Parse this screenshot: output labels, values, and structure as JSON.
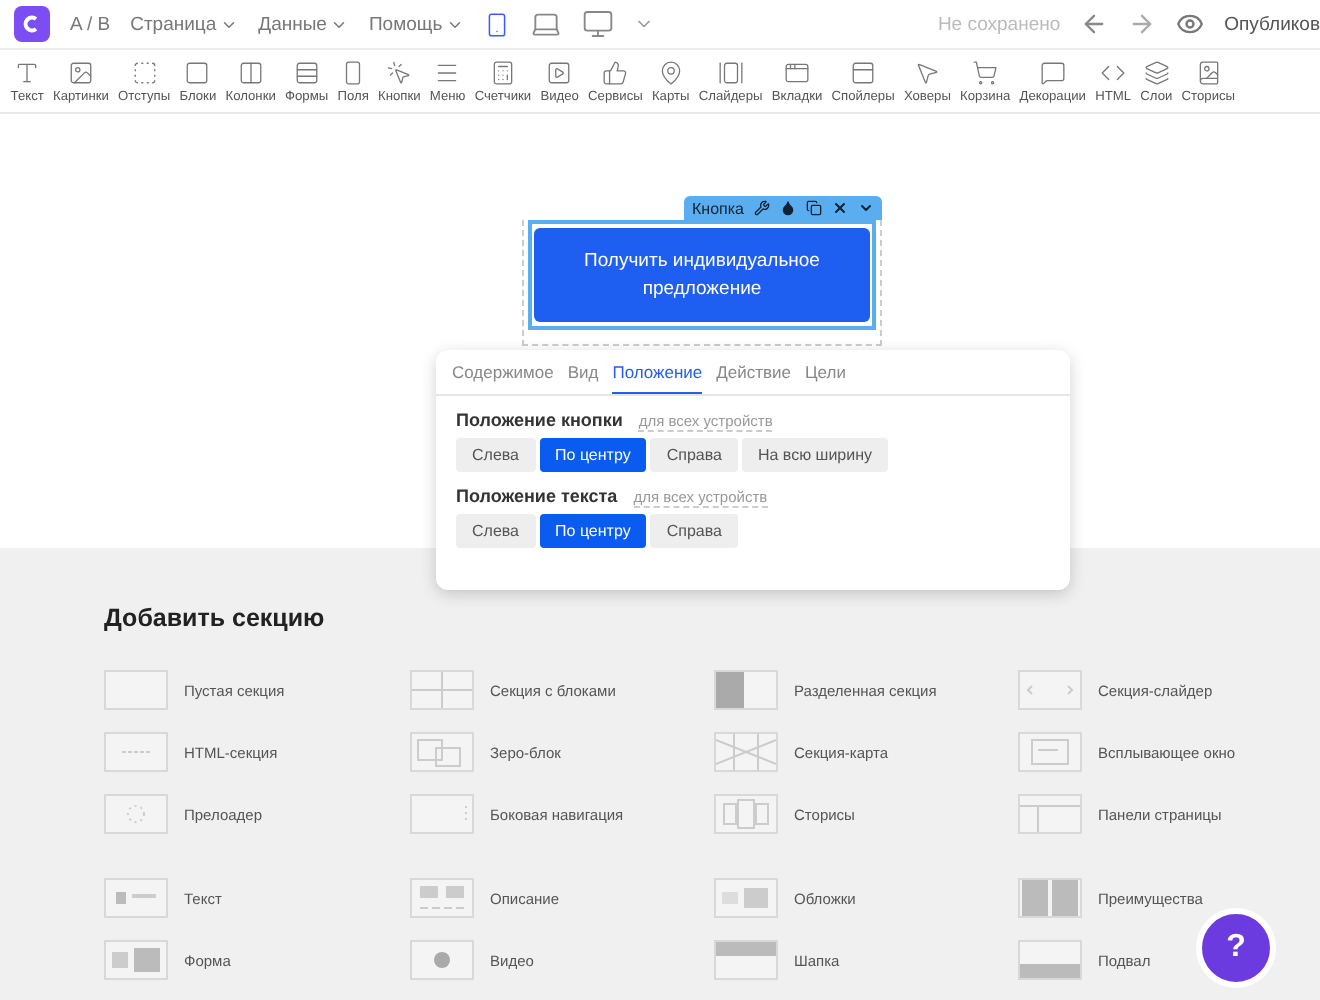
{
  "topbar": {
    "ab": "A / B",
    "menus": [
      "Страница",
      "Данные",
      "Помощь"
    ],
    "devices": [
      {
        "kind": "phone",
        "selected": true
      },
      {
        "kind": "laptop",
        "selected": false
      },
      {
        "kind": "desktop",
        "selected": false
      }
    ],
    "status": "Не сохранено",
    "publish": "Опубликов"
  },
  "toolbar": [
    "Текст",
    "Картинки",
    "Отступы",
    "Блоки",
    "Колонки",
    "Формы",
    "Поля",
    "Кнопки",
    "Меню",
    "Счетчики",
    "Видео",
    "Сервисы",
    "Карты",
    "Слайдеры",
    "Вкладки",
    "Спойлеры",
    "Ховеры",
    "Корзина",
    "Декорации",
    "HTML",
    "Слои",
    "Сторисы"
  ],
  "editor": {
    "block_label": "Кнопка",
    "button_text": "Получить индивидуальное предложение"
  },
  "panel": {
    "tabs": [
      {
        "label": "Содержимое",
        "selected": false
      },
      {
        "label": "Вид",
        "selected": false
      },
      {
        "label": "Положение",
        "selected": true
      },
      {
        "label": "Действие",
        "selected": false
      },
      {
        "label": "Цели",
        "selected": false
      }
    ],
    "groups": [
      {
        "title": "Положение кнопки",
        "hint": "для всех устройств",
        "options": [
          {
            "label": "Слева",
            "selected": false
          },
          {
            "label": "По центру",
            "selected": true
          },
          {
            "label": "Справа",
            "selected": false
          },
          {
            "label": "На всю ширину",
            "selected": false
          }
        ]
      },
      {
        "title": "Положение текста",
        "hint": "для всех устройств",
        "options": [
          {
            "label": "Слева",
            "selected": false
          },
          {
            "label": "По центру",
            "selected": true
          },
          {
            "label": "Справа",
            "selected": false
          }
        ]
      }
    ]
  },
  "add_section": {
    "title": "Добавить секцию",
    "groups": [
      [
        "Пустая секция",
        "Секция с блоками",
        "Разделенная секция",
        "Секция-слайдер",
        "HTML-секция",
        "Зеро-блок",
        "Секция-карта",
        "Всплывающее окно",
        "Прелоадер",
        "Боковая навигация",
        "Сторисы",
        "Панели страницы"
      ],
      [
        "Текст",
        "Описание",
        "Обложки",
        "Преимущества",
        "Форма",
        "Видео",
        "Шапка",
        "Подвал"
      ]
    ]
  },
  "help": "?"
}
